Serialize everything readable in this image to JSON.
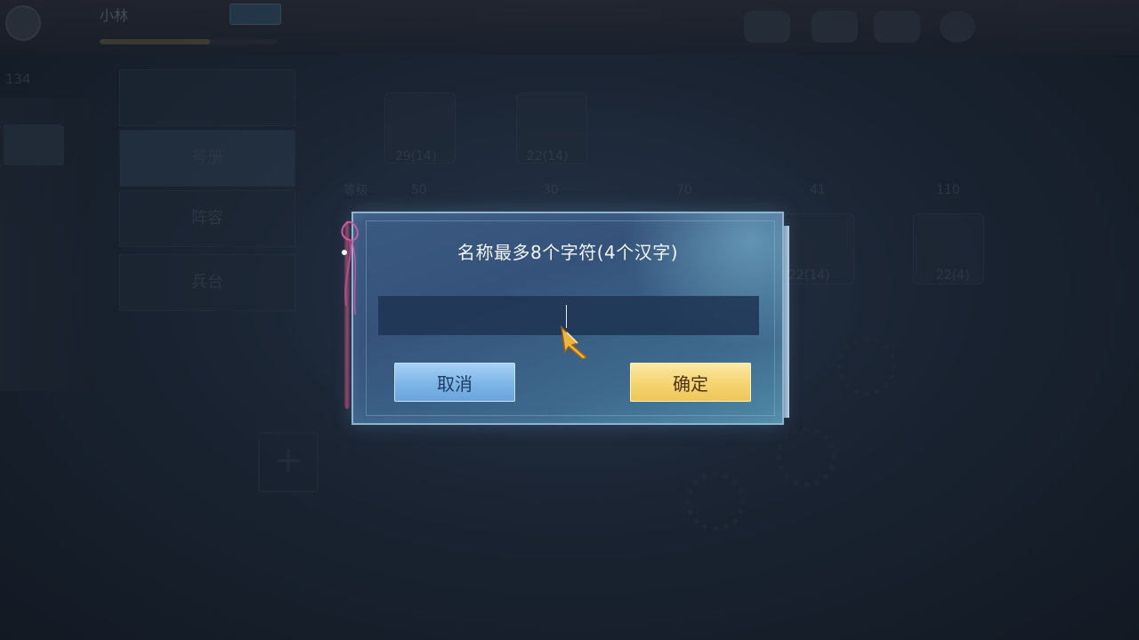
{
  "background": {
    "player_name": "小林",
    "side_value": "134",
    "menu_buttons": [
      "号册",
      "阵容",
      "兵台"
    ],
    "slot_labels": [
      "29(14)",
      "22(14)",
      "22(14)",
      "22(4)"
    ],
    "level_labels": [
      "等级",
      "50",
      "30",
      "70",
      "41",
      "110"
    ],
    "exp_progress": 0.62
  },
  "dialog": {
    "title": "名称最多8个字符(4个汉字)",
    "input_value": "",
    "input_placeholder": "",
    "cancel_label": "取消",
    "confirm_label": "确定"
  },
  "colors": {
    "dialog_bg": "#35527a",
    "cancel_btn": "#7cb4e6",
    "confirm_btn": "#f5d470",
    "input_bg": "#1e3452"
  }
}
